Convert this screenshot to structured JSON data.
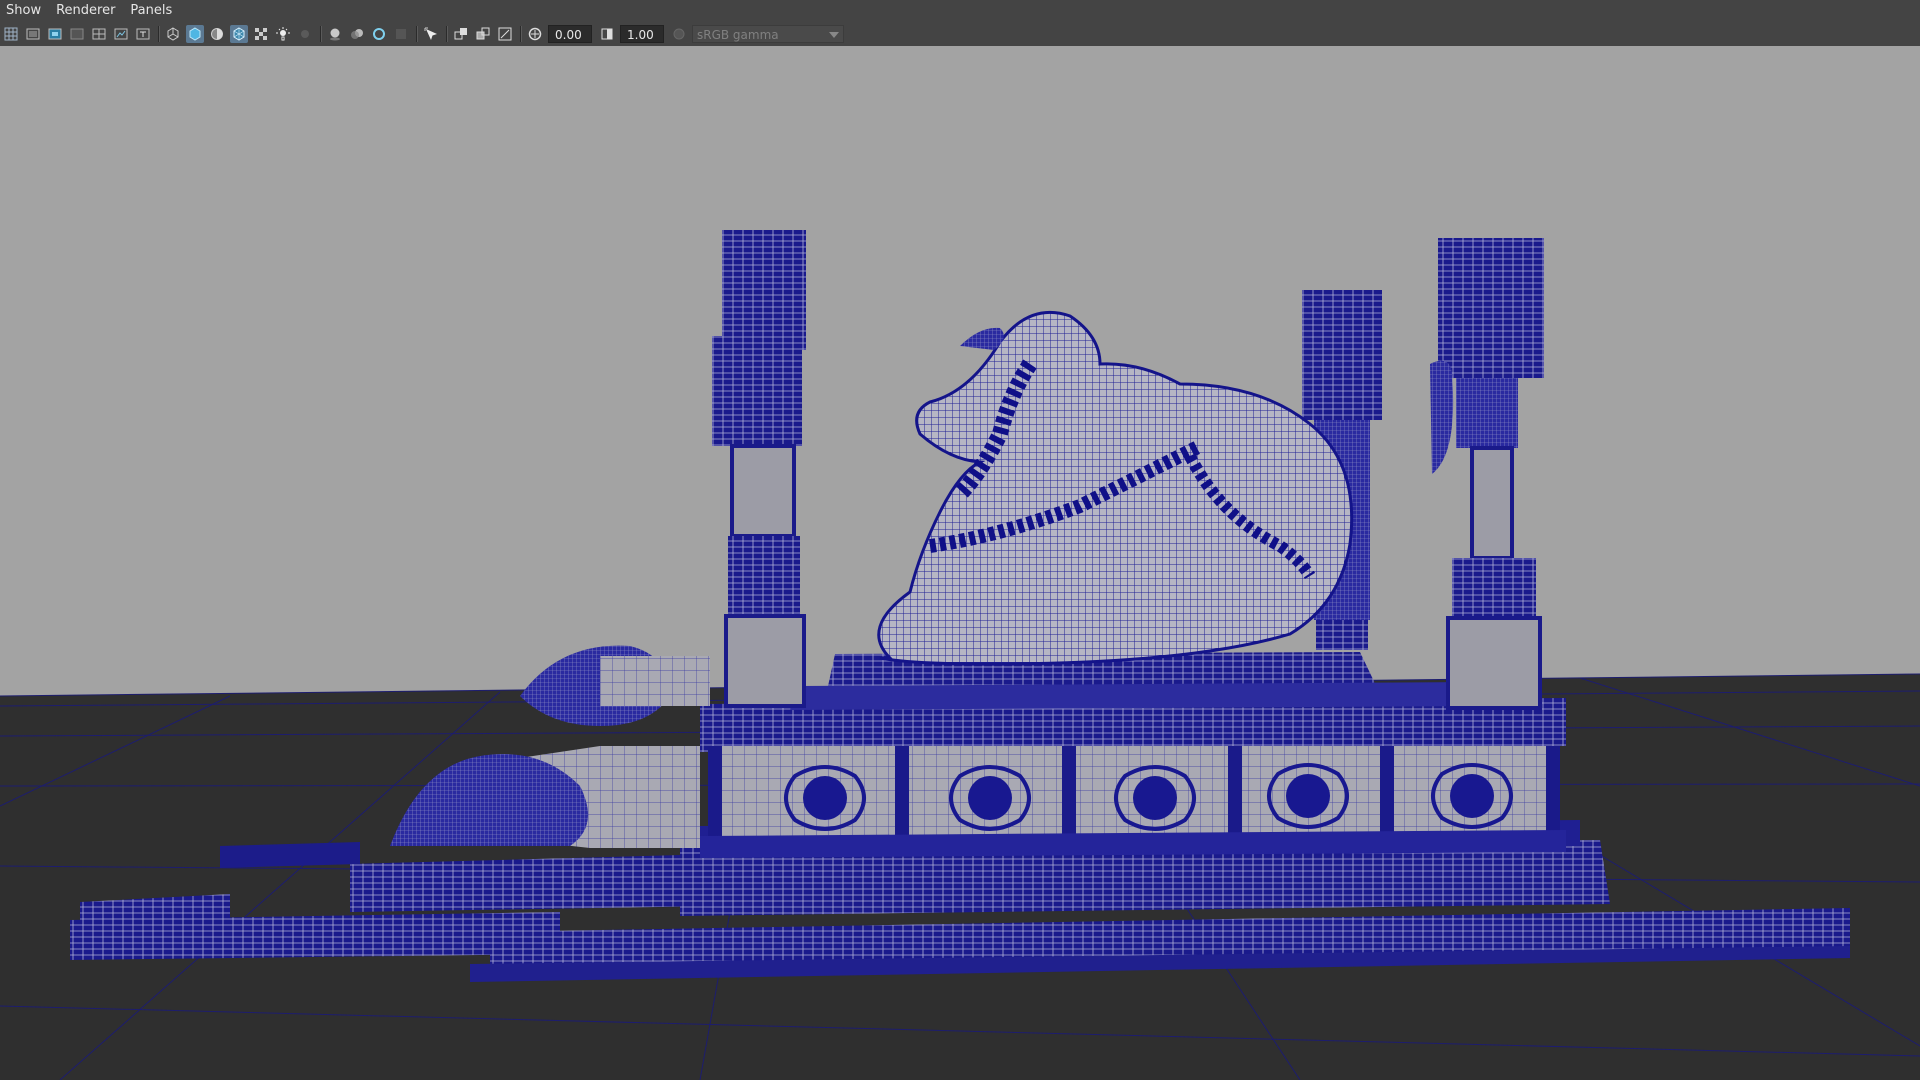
{
  "menu": {
    "items": [
      "Show",
      "Renderer",
      "Panels"
    ]
  },
  "toolbar": {
    "exposure_value": "0.00",
    "gamma_value": "1.00",
    "color_space": "sRGB gamma"
  },
  "icons": [
    "grid-icon",
    "film-gate-icon",
    "resolution-gate-icon",
    "gate-mask-icon",
    "field-chart-icon",
    "safe-action-icon",
    "safe-title-icon",
    "wireframe-icon",
    "smooth-shade-icon",
    "default-material-icon",
    "wireframe-on-shaded-icon",
    "textured-icon",
    "lights-icon",
    "shadows-icon",
    "ambient-occlusion-icon",
    "motion-blur-icon",
    "anti-aliasing-icon",
    "depth-of-field-icon",
    "select-camera-icon",
    "isolate-select-icon",
    "xray-icon",
    "xray-joints-icon",
    "exposure-icon",
    "gamma-icon",
    "color-management-icon"
  ],
  "colors": {
    "viewport_bg": "#a3a3a3",
    "floor": "#2f2f2f",
    "wireframe": "#12128a",
    "menubar": "#444444"
  }
}
